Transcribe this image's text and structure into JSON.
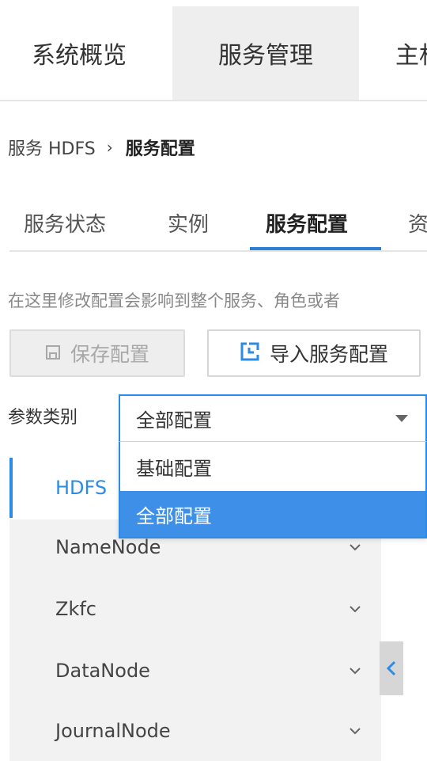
{
  "top_nav": {
    "items": [
      {
        "label": "系统概览"
      },
      {
        "label": "服务管理"
      },
      {
        "label": "主机"
      }
    ]
  },
  "breadcrumb": {
    "service": "服务 HDFS",
    "separator": "›",
    "current": "服务配置"
  },
  "sub_tabs": {
    "items": [
      {
        "label": "服务状态"
      },
      {
        "label": "实例"
      },
      {
        "label": "服务配置"
      },
      {
        "label": "资"
      }
    ],
    "active_index": 2
  },
  "description": "在这里修改配置会影响到整个服务、角色或者",
  "toolbar": {
    "save_label": "保存配置",
    "import_label": "导入服务配置"
  },
  "param_category": {
    "label": "参数类别",
    "selected": "全部配置",
    "options": [
      "基础配置",
      "全部配置"
    ]
  },
  "tree": {
    "root": "HDFS",
    "items": [
      {
        "label": "NameNode"
      },
      {
        "label": "Zkfc"
      },
      {
        "label": "DataNode"
      },
      {
        "label": "JournalNode"
      }
    ]
  },
  "colors": {
    "accent": "#2b8be6",
    "selected_option_bg": "#3d8fe8",
    "active_nav_bg": "#eeeeee",
    "tree_bg": "#f2f2f2"
  },
  "icons": {
    "save": "floppy-disk-icon",
    "import": "import-bracket-icon",
    "caret": "caret-down-icon",
    "chevron": "chevron-down-icon",
    "collapse": "chevron-left-icon"
  }
}
